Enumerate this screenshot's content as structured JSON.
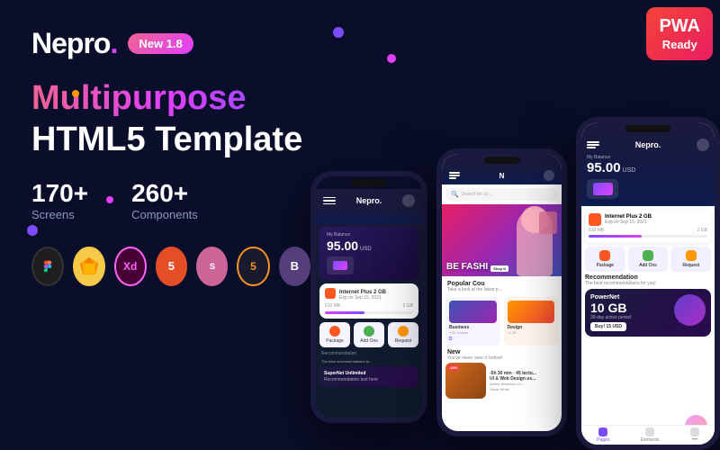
{
  "brand": {
    "name": "Nepro",
    "dot": ".",
    "badge": "New 1.8"
  },
  "headline": {
    "line1": "Multipurpose",
    "line2": "HTML5 Template"
  },
  "stats": {
    "screens": "170+",
    "screens_label": "Screens",
    "components": "260+",
    "components_label": "Components"
  },
  "tech_icons": [
    {
      "name": "Figma",
      "symbol": "F",
      "key": "figma"
    },
    {
      "name": "Sketch",
      "symbol": "S",
      "key": "sketch"
    },
    {
      "name": "XD",
      "symbol": "Xd",
      "key": "xd"
    },
    {
      "name": "HTML5",
      "symbol": "5",
      "key": "html"
    },
    {
      "name": "Sass",
      "symbol": "S",
      "key": "sass"
    },
    {
      "name": "HTML5",
      "symbol": "5",
      "key": "html5"
    },
    {
      "name": "Bootstrap",
      "symbol": "B",
      "key": "bootstrap"
    }
  ],
  "pwa": {
    "line1": "PWA",
    "line2": "Ready"
  },
  "phone1": {
    "logo": "Nepro.",
    "my_balance_label": "My Balance",
    "balance": "95.00",
    "currency": "USD",
    "card_title": "Internet Plus 2 GB",
    "card_subtitle": "Exp on Sep 15, 2021",
    "data_used": "610 MB",
    "data_total": "2 GB",
    "actions": [
      "Package",
      "Add Ons",
      "Request"
    ]
  },
  "phone2": {
    "logo": "N",
    "search_placeholder": "Search for co...",
    "fashion_text": "BE FASHI",
    "shop_now": "Shop N",
    "section_title": "Popular Cou",
    "section_subtitle": "Take a look at the latest p...",
    "new_label": "New",
    "new_sub": "You've never seen it before!",
    "badge_label": "-15%"
  },
  "phone3": {
    "logo": "Nepro.",
    "my_balance_label": "My Balance",
    "balance": "95.00",
    "currency": "USD",
    "internet_title": "Internet Plus 2 GB",
    "internet_subtitle": "Exp on Sep 15, 2021",
    "data_used": "610 MB",
    "data_total": "2 GB",
    "pkg_actions": [
      "Package",
      "Add Ons",
      "Request"
    ],
    "recommendation_title": "Recommendation",
    "recommendation_sub": "The best recommendations for you!",
    "power_brand": "PowerNet",
    "power_data": "10 GB",
    "power_period": "30-day active period",
    "buy_label": "Buy! 15 USD",
    "nav_items": [
      "Pages",
      "Elements",
      ""
    ]
  },
  "colors": {
    "bg_dark": "#0a0e2a",
    "gradient_start": "#f06292",
    "gradient_end": "#7c4dff",
    "accent_purple": "#7c4dff",
    "accent_pink": "#e040fb",
    "pwa_red": "#f44336"
  }
}
